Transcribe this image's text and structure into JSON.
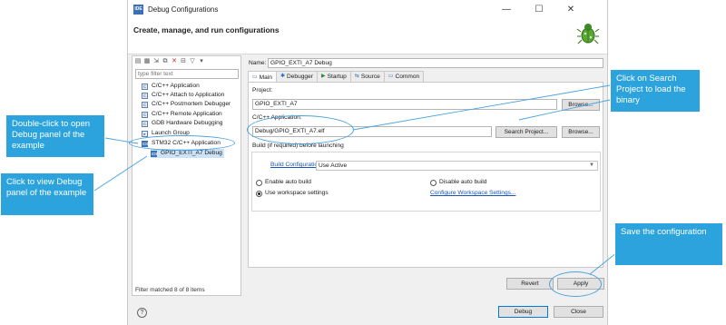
{
  "window": {
    "app_icon_text": "IDE",
    "title": "Debug Configurations",
    "header_title": "Create, manage, and run configurations",
    "minimize_glyph": "—",
    "maximize_glyph": "☐",
    "close_glyph": "✕"
  },
  "left": {
    "toolbar_icons": [
      "new-config-icon",
      "new-prototype-icon",
      "export-icon",
      "duplicate-icon",
      "delete-icon",
      "collapse-all-icon",
      "filter-icon",
      "dropdown-icon"
    ],
    "filter_placeholder": "type filter text",
    "tree": [
      {
        "label": "C/C++ Application",
        "icon": "C"
      },
      {
        "label": "C/C++ Attach to Application",
        "icon": "C"
      },
      {
        "label": "C/C++ Postmortem Debugger",
        "icon": "C"
      },
      {
        "label": "C/C++ Remote Application",
        "icon": "C"
      },
      {
        "label": "GDB Hardware Debugging",
        "icon": "C"
      },
      {
        "label": "Launch Group",
        "icon": "▸"
      },
      {
        "label": "STM32 C/C++ Application",
        "icon": "IDE"
      },
      {
        "label": "GPIO_EXTI_A7 Debug",
        "icon": "IDE"
      }
    ],
    "status": "Filter matched 8 of 8 items"
  },
  "right": {
    "name_label": "Name:",
    "name_value": "GPIO_EXTI_A7 Debug",
    "tabs": [
      {
        "label": "Main",
        "icon": "▭"
      },
      {
        "label": "Debugger",
        "icon": "✱"
      },
      {
        "label": "Startup",
        "icon": "▶"
      },
      {
        "label": "Source",
        "icon": "⇆"
      },
      {
        "label": "Common",
        "icon": "▭"
      }
    ],
    "project_label": "Project:",
    "project_value": "GPIO_EXTI_A7",
    "browse_label": "Browse...",
    "application_label": "C/C++ Application:",
    "application_value": "Debug/GPIO_EXTI_A7.elf",
    "search_project_label": "Search Project...",
    "build_group_label": "Build (if required) before launching",
    "build_config_link": "Build Configuration:",
    "build_config_value": "Use Active",
    "enable_auto_build": "Enable auto build",
    "disable_auto_build": "Disable auto build",
    "use_workspace_settings": "Use workspace settings",
    "configure_workspace_link": "Configure Workspace Settings...",
    "revert_label": "Revert",
    "apply_label": "Apply"
  },
  "bottom": {
    "help_glyph": "?",
    "debug_label": "Debug",
    "close_label": "Close"
  },
  "callouts": {
    "search_project": "Click on Search Project to load the binary",
    "double_click": "Double-click to open Debug panel of the example",
    "click_view": "Click to view Debug panel of  the example",
    "save_config": "Save the configuration"
  },
  "colors": {
    "callout": "#2ca3dd",
    "annotation_line": "#4aa3e0",
    "selection": "#cce3f7",
    "link": "#1a55b5"
  }
}
